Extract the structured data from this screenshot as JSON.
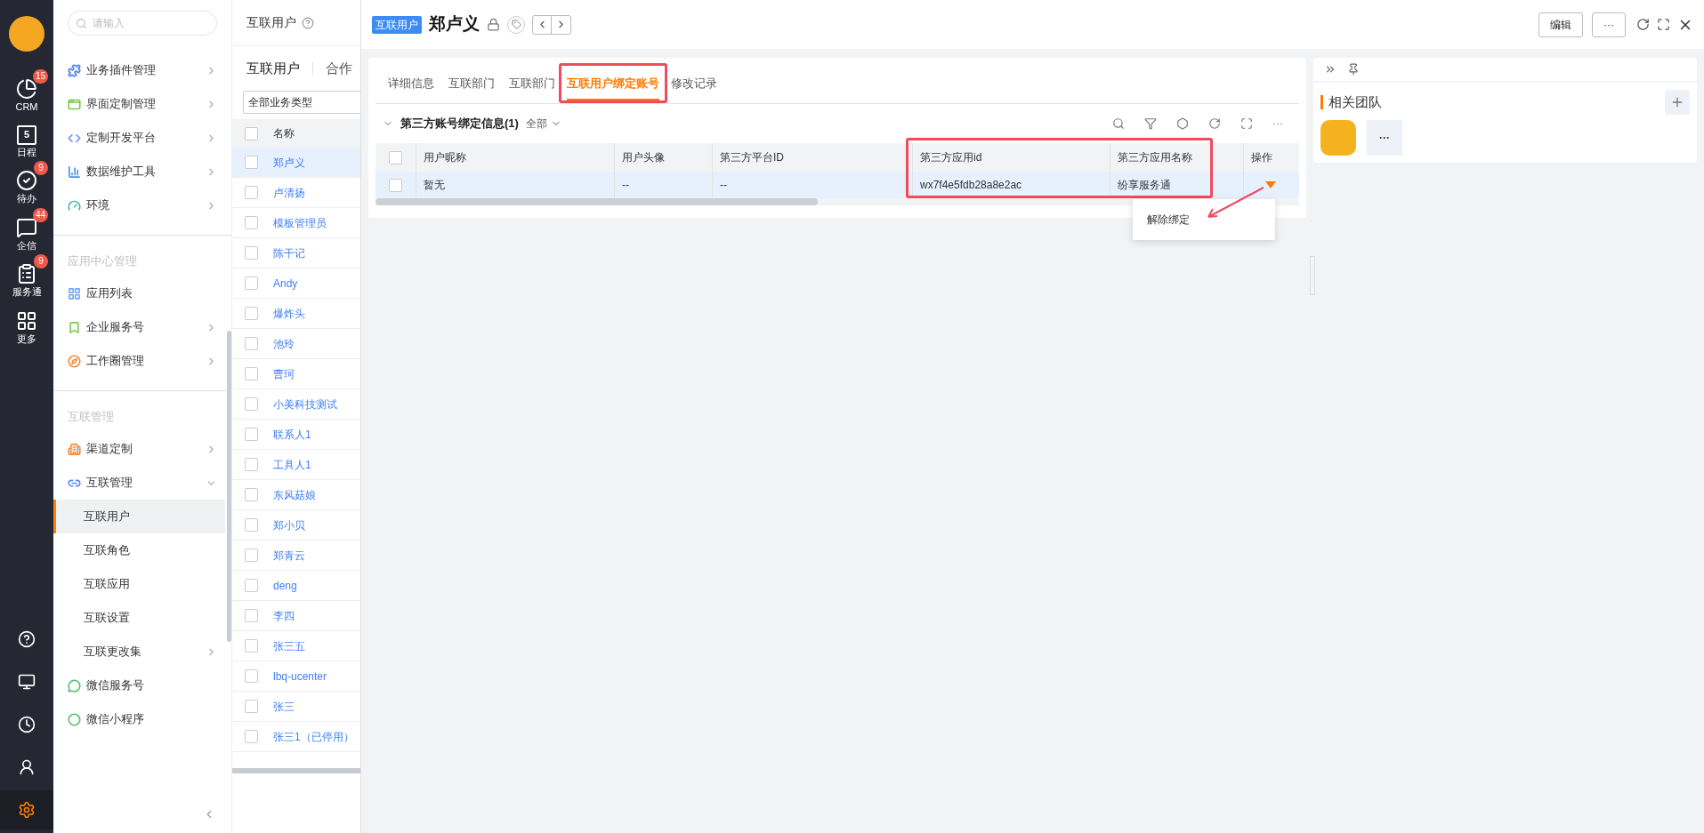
{
  "rail": {
    "top": [
      {
        "label": "CRM",
        "badge": "15",
        "selected": false
      },
      {
        "label": "日程",
        "day": "5",
        "selected": false
      },
      {
        "label": "待办",
        "badge": "9",
        "selected": false
      },
      {
        "label": "企信",
        "badge": "44",
        "selected": false
      },
      {
        "label": "服务通",
        "badge": "9",
        "selected": false
      },
      {
        "label": "更多",
        "selected": false
      }
    ],
    "bottom": [
      {
        "selected": false
      },
      {
        "selected": false
      },
      {
        "selected": false
      },
      {
        "selected": false
      },
      {
        "selected": true
      }
    ]
  },
  "nav": {
    "search": {
      "placeholder": "请输入"
    },
    "sections": [
      {
        "items": [
          {
            "label": "业务插件管理",
            "kind": "submenu",
            "expanded": false,
            "color": "#4a7cf7"
          },
          {
            "label": "界面定制管理",
            "kind": "submenu",
            "expanded": false,
            "color": "#7bc94c"
          },
          {
            "label": "定制开发平台",
            "kind": "submenu",
            "expanded": false,
            "color": "#6b8ff7"
          },
          {
            "label": "数据维护工具",
            "kind": "submenu",
            "expanded": false,
            "color": "#4a90e2"
          },
          {
            "label": "环境",
            "kind": "submenu",
            "expanded": false,
            "color": "#3bb4a6"
          }
        ]
      },
      {
        "title": "应用中心管理",
        "items": [
          {
            "label": "应用列表",
            "kind": "link",
            "color": "#6aa7f8"
          },
          {
            "label": "企业服务号",
            "kind": "submenu",
            "expanded": false,
            "color": "#7bc94c"
          },
          {
            "label": "工作圈管理",
            "kind": "submenu",
            "expanded": false,
            "color": "#f28b3c"
          }
        ]
      },
      {
        "title": "互联管理",
        "items": [
          {
            "label": "渠道定制",
            "kind": "submenu",
            "expanded": false,
            "color": "#f28b3c"
          },
          {
            "label": "互联管理",
            "kind": "submenu",
            "expanded": true,
            "color": "#5b8ff9",
            "children": [
              {
                "label": "互联用户",
                "selected": true,
                "kind": "link"
              },
              {
                "label": "互联角色",
                "selected": false,
                "kind": "link"
              },
              {
                "label": "互联应用",
                "selected": false,
                "kind": "link"
              },
              {
                "label": "互联设置",
                "selected": false,
                "kind": "link"
              },
              {
                "label": "互联更改集",
                "selected": false,
                "kind": "submenu",
                "expanded": false
              }
            ]
          },
          {
            "label": "微信服务号",
            "kind": "link",
            "color": "#52c46a"
          },
          {
            "label": "微信小程序",
            "kind": "link",
            "color": "#52c46a"
          }
        ]
      }
    ]
  },
  "list": {
    "title": "互联用户",
    "tabs": [
      {
        "label": "互联用户",
        "selected": true
      },
      {
        "label": "合作",
        "selected": false
      }
    ],
    "filter": "全部业务类型",
    "column": "名称",
    "all_checked": false,
    "rows": [
      {
        "name": "郑卢义",
        "selected": true
      },
      {
        "name": "卢清扬",
        "selected": false
      },
      {
        "name": "模板管理员",
        "selected": false
      },
      {
        "name": "陈干记",
        "selected": false
      },
      {
        "name": "Andy",
        "selected": false
      },
      {
        "name": "爆炸头",
        "selected": false
      },
      {
        "name": "池玲",
        "selected": false
      },
      {
        "name": "曹珂",
        "selected": false
      },
      {
        "name": "小美科技测试",
        "selected": false
      },
      {
        "name": "联系人1",
        "selected": false
      },
      {
        "name": "工具人1",
        "selected": false
      },
      {
        "name": "东风菇娘",
        "selected": false
      },
      {
        "name": "郑小贝",
        "selected": false
      },
      {
        "name": "郑青云",
        "selected": false
      },
      {
        "name": "deng",
        "selected": false
      },
      {
        "name": "李四",
        "selected": false
      },
      {
        "name": "张三五",
        "selected": false
      },
      {
        "name": "lbq-ucenter",
        "selected": false
      },
      {
        "name": "张三",
        "selected": false
      },
      {
        "name": "张三1（已停用）",
        "selected": false
      }
    ]
  },
  "detail": {
    "tag": "互联用户",
    "title": "郑卢义",
    "edit": "编辑",
    "more": "···",
    "tabs": [
      {
        "label": "详细信息",
        "selected": false
      },
      {
        "label": "互联部门",
        "selected": false
      },
      {
        "label": "互联部门",
        "selected": false
      },
      {
        "label": "互联用户绑定账号",
        "selected": true
      },
      {
        "label": "修改记录",
        "selected": false
      }
    ],
    "section": {
      "title": "第三方账号绑定信息(1)",
      "expanded": true,
      "filter": "全部",
      "more": "···"
    },
    "table": {
      "all_checked": false,
      "columns": [
        "用户昵称",
        "用户头像",
        "第三方平台ID",
        "第三方应用id",
        "第三方应用名称",
        "操作"
      ],
      "rows": [
        {
          "selected": true,
          "checked": false,
          "cells": [
            "暂无",
            "--",
            "--",
            "wx7f4e5fdb28a8e2ac",
            "纷享服务通"
          ]
        }
      ]
    },
    "menu": [
      "解除绑定"
    ]
  },
  "side": {
    "title": "相关团队",
    "more": "···"
  }
}
